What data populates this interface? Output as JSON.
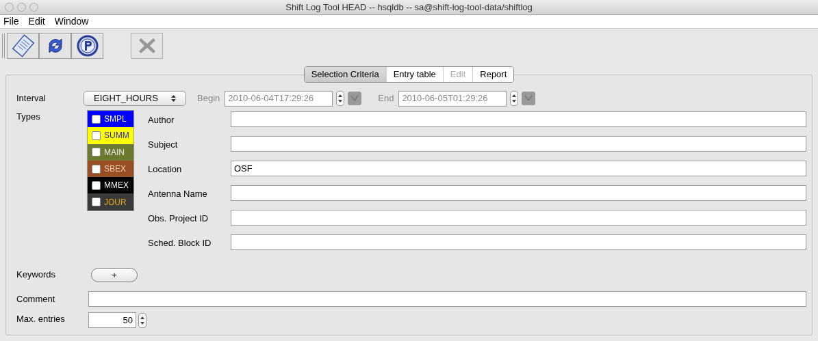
{
  "window": {
    "title": "Shift Log Tool HEAD -- hsqldb -- sa@shift-log-tool-data/shiftlog"
  },
  "menu": [
    "File",
    "Edit",
    "Window"
  ],
  "toolbar": [
    {
      "kind": "document"
    },
    {
      "kind": "refresh"
    },
    {
      "kind": "p-badge"
    },
    {
      "kind": "close",
      "disabled": true
    }
  ],
  "tabs": [
    {
      "label": "Selection Criteria",
      "selected": true,
      "disabled": false
    },
    {
      "label": "Entry table",
      "selected": false,
      "disabled": false
    },
    {
      "label": "Edit",
      "selected": false,
      "disabled": true
    },
    {
      "label": "Report",
      "selected": false,
      "disabled": false
    }
  ],
  "interval": {
    "label": "Interval",
    "value": "EIGHT_HOURS"
  },
  "begin": {
    "label": "Begin",
    "value": "2010-06-04T17:29:26",
    "disabled": true
  },
  "end": {
    "label": "End",
    "value": "2010-06-05T01:29:26",
    "disabled": true
  },
  "types": {
    "label": "Types",
    "items": [
      {
        "label": "SMPL",
        "color": "#ffffff",
        "background": {
          "color": "#0000ff"
        },
        "checked": false
      },
      {
        "label": "SUMM",
        "color": "#1a1acc",
        "background": {
          "color": "#ffff00"
        },
        "checked": false
      },
      {
        "label": "MAIN",
        "color": "#f0f0f0",
        "background": {
          "color": "#6b7a2e"
        },
        "checked": false
      },
      {
        "label": "SBEX",
        "color": "#f5d0b0",
        "background": {
          "color": "#9a4e24"
        },
        "checked": false
      },
      {
        "label": "MMEX",
        "color": "#ffffff",
        "background": {
          "color": "#000000"
        },
        "checked": false
      },
      {
        "label": "JOUR",
        "color": "#e6a817",
        "background": {
          "color": "#3a3a3a"
        },
        "checked": false
      }
    ]
  },
  "fields": [
    {
      "label": "Author"
    },
    {
      "label": "Subject"
    },
    {
      "label": "Location",
      "value": "OSF"
    },
    {
      "label": "Antenna Name"
    },
    {
      "label": "Obs. Project ID"
    },
    {
      "label": "Sched. Block ID"
    }
  ],
  "keywords": {
    "label": "Keywords",
    "button": "+"
  },
  "comment": {
    "label": "Comment"
  },
  "max_entries": {
    "label": "Max. entries",
    "value": "50"
  }
}
